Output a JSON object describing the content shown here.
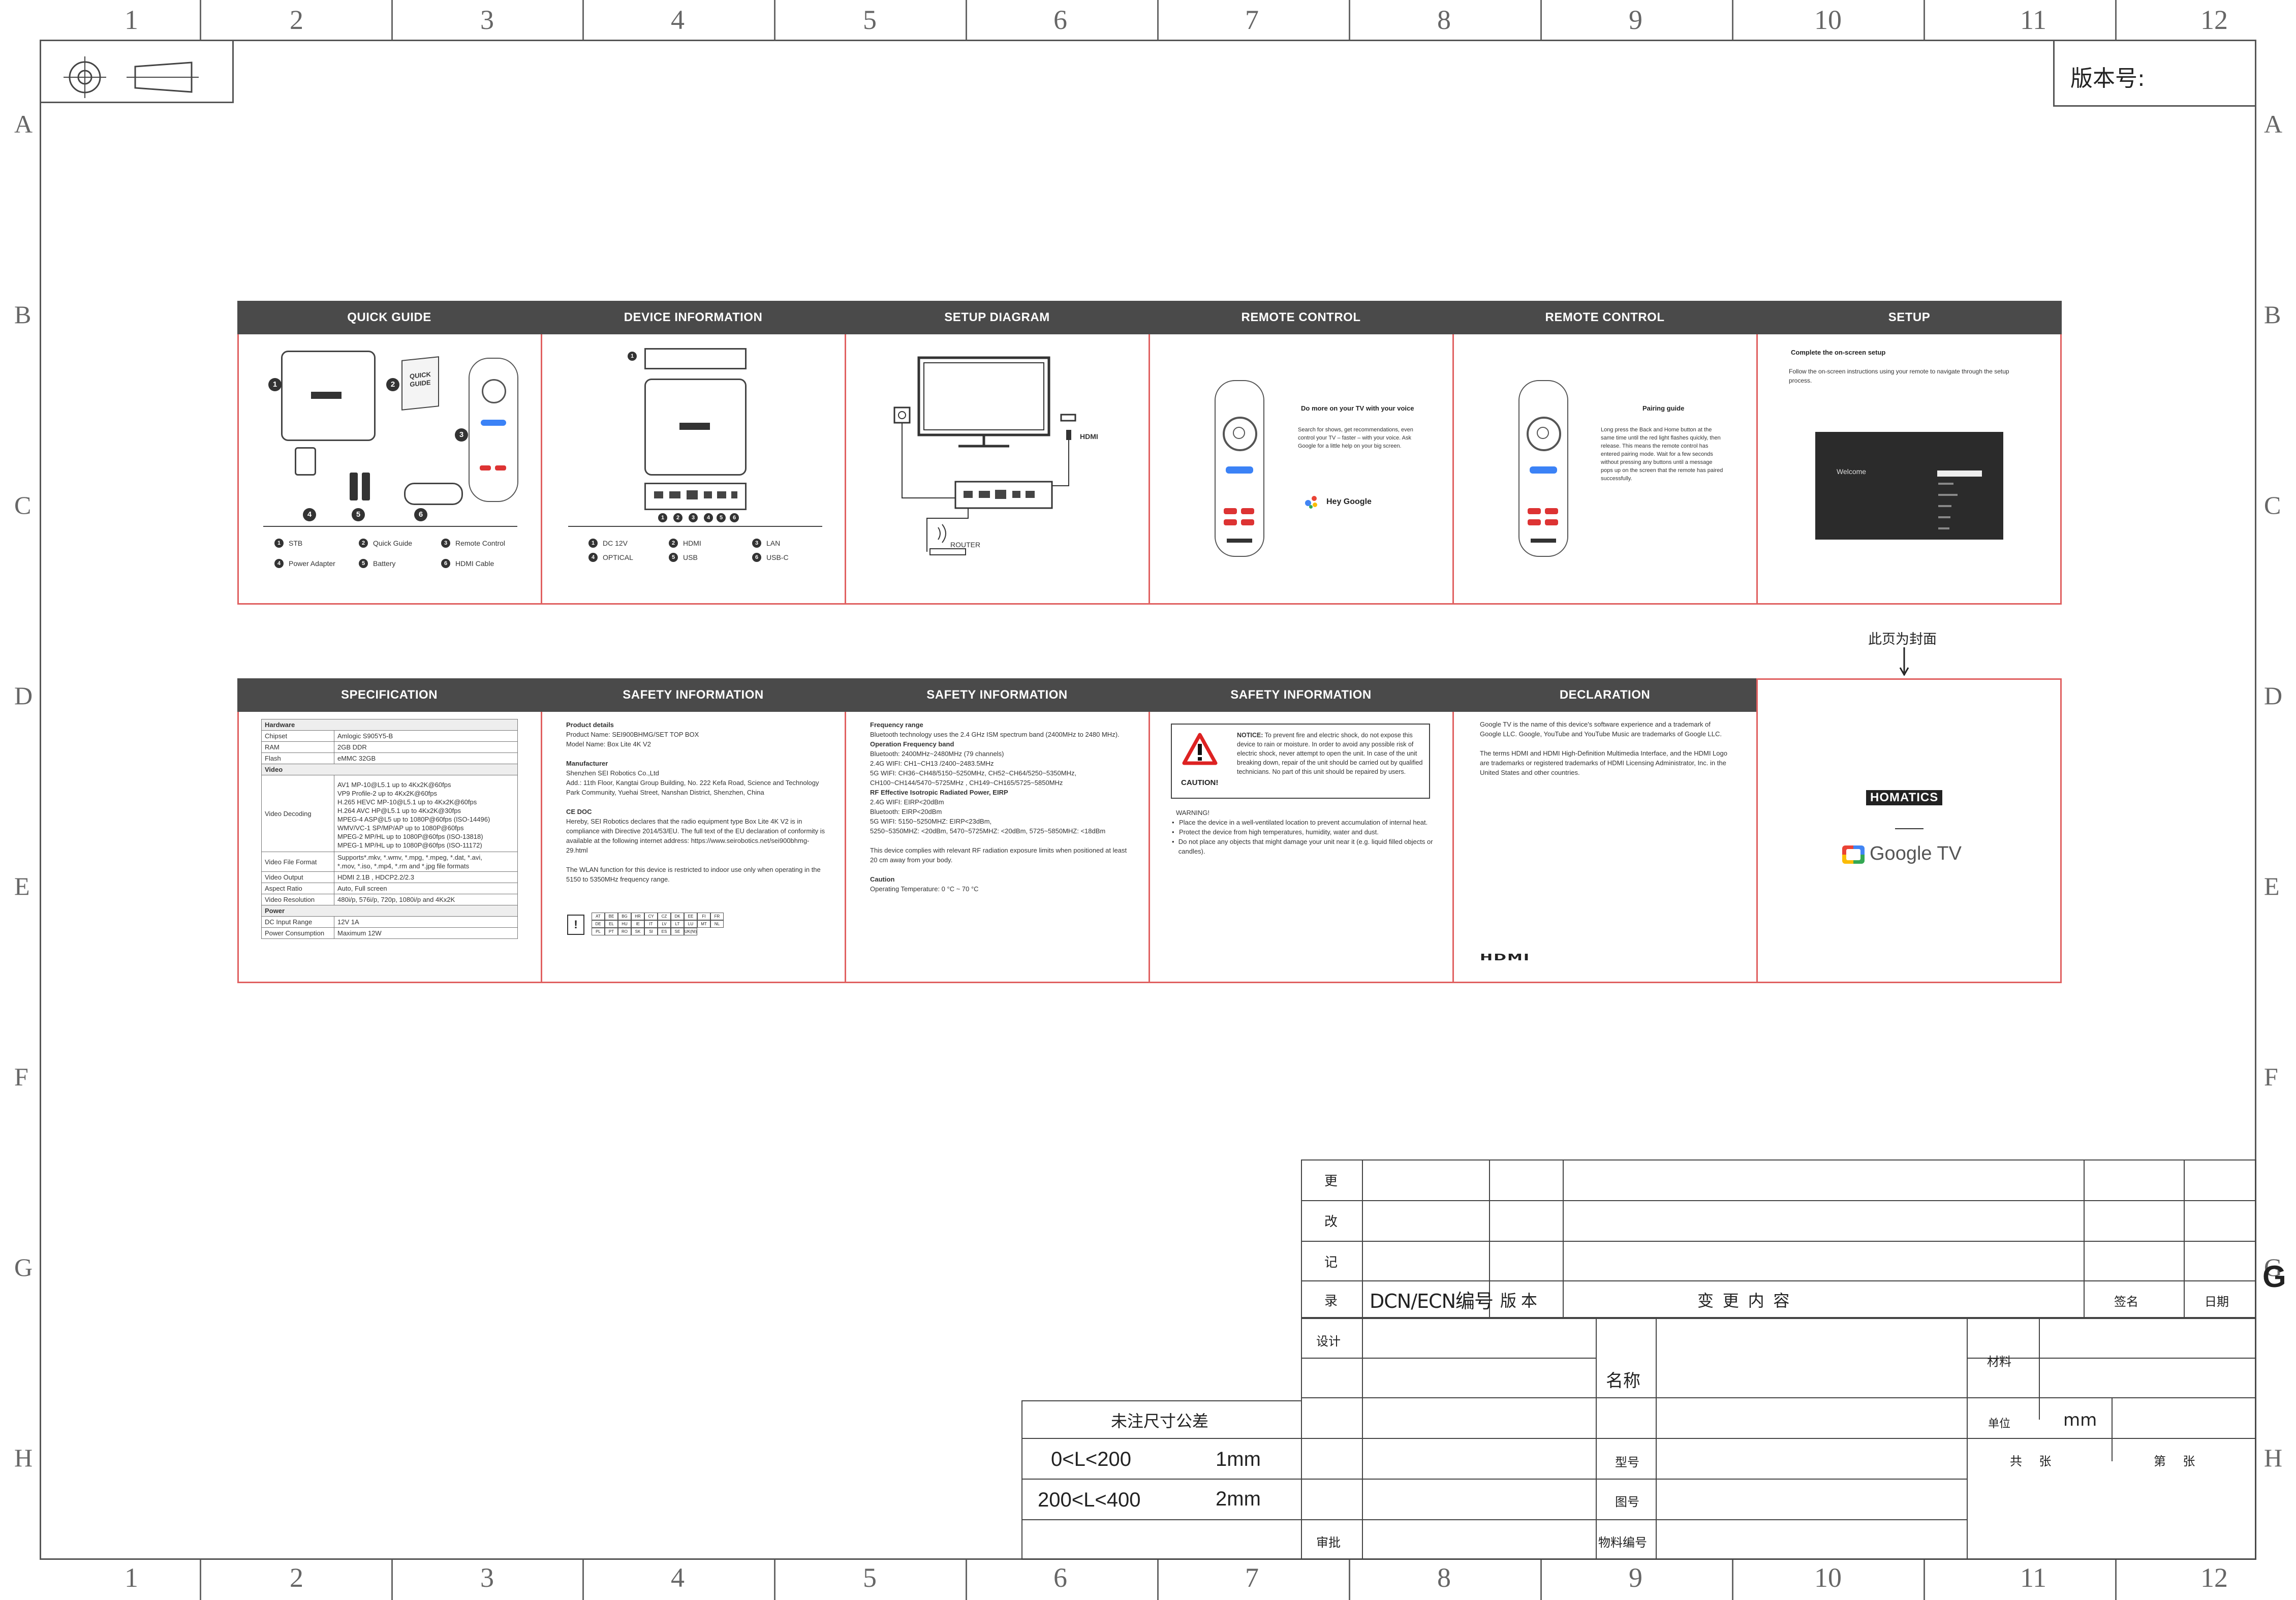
{
  "sheet": {
    "version_label": "版本号:",
    "cover_note": "此页为封面",
    "ruler_numbers": [
      "1",
      "2",
      "3",
      "4",
      "5",
      "6",
      "7",
      "8",
      "9",
      "10",
      "11",
      "12"
    ],
    "ruler_letters": [
      "A",
      "B",
      "C",
      "D",
      "E",
      "F",
      "G",
      "H"
    ],
    "ruler_g_mark": "G"
  },
  "top_row": {
    "headers": [
      "QUICK GUIDE",
      "DEVICE INFORMATION",
      "SETUP DIAGRAM",
      "REMOTE CONTROL",
      "REMOTE CONTROL",
      "SETUP"
    ],
    "quick_guide": {
      "booklet_label": "QUICK GUIDE",
      "legend": [
        {
          "num": "1",
          "text": "STB"
        },
        {
          "num": "2",
          "text": "Quick Guide"
        },
        {
          "num": "3",
          "text": "Remote Control"
        },
        {
          "num": "4",
          "text": "Power Adapter"
        },
        {
          "num": "5",
          "text": "Battery"
        },
        {
          "num": "6",
          "text": "HDMI Cable"
        }
      ]
    },
    "device_info": {
      "legend": [
        {
          "num": "1",
          "text": "DC 12V"
        },
        {
          "num": "2",
          "text": "HDMI"
        },
        {
          "num": "3",
          "text": "LAN"
        },
        {
          "num": "4",
          "text": "OPTICAL"
        },
        {
          "num": "5",
          "text": "USB"
        },
        {
          "num": "6",
          "text": "USB-C"
        }
      ]
    },
    "setup_diagram": {
      "hdmi_label": "HDMI",
      "router_label": "ROUTER"
    },
    "remote1": {
      "title": "Do more on your TV with your voice",
      "body": "Search for shows, get recommendations, even control your TV – faster – with your voice. Ask Google for a little help on your big screen.",
      "hey_google": "Hey Google"
    },
    "remote2": {
      "title": "Pairing guide",
      "body": "Long press the Back and Home button at the same time until the red light flashes quickly, then release. This means the remote control has entered pairing mode. Wait for a few seconds without pressing any buttons until a message pops up on the screen that the remote has paired successfully."
    },
    "setup": {
      "title": "Complete the on-screen setup",
      "body": "Follow the on-screen instructions using your remote to navigate through the setup process.",
      "welcome": "Welcome"
    }
  },
  "bottom_row": {
    "headers": [
      "SPECIFICATION",
      "SAFETY INFORMATION",
      "SAFETY INFORMATION",
      "SAFETY INFORMATION",
      "DECLARATION"
    ],
    "spec_table": [
      {
        "type": "section",
        "label": "Hardware"
      },
      {
        "k": "Chipset",
        "v": "Amlogic S905Y5-B"
      },
      {
        "k": "RAM",
        "v": "2GB DDR"
      },
      {
        "k": "Flash",
        "v": "eMMC 32GB"
      },
      {
        "type": "section",
        "label": "Video"
      },
      {
        "k": "Video Decoding",
        "v": "AV1 MP-10@L5.1 up to 4Kx2K@60fps\nVP9 Profile-2 up to 4Kx2K@60fps\nH.265 HEVC MP-10@L5.1 up to 4Kx2K@60fps\nH.264 AVC HP@L5.1 up to 4Kx2K@30fps\nMPEG-4 ASP@L5 up to 1080P@60fps (ISO-14496)\nWMV/VC-1 SP/MP/AP up to 1080P@60fps\nMPEG-2 MP/HL up to 1080P@60fps (ISO-13818)\nMPEG-1 MP/HL up to 1080P@60fps (ISO-11172)"
      },
      {
        "k": "Video File Format",
        "v": "Supports*.mkv, *.wmv, *.mpg, *.mpeg, *.dat, *.avi,\n*.mov, *.iso, *.mp4, *.rm and *.jpg file formats"
      },
      {
        "k": "Video Output",
        "v": "HDMI 2.1B , HDCP2.2/2.3"
      },
      {
        "k": "Aspect Ratio",
        "v": "Auto, Full screen"
      },
      {
        "k": "Video Resolution",
        "v": "480i/p, 576i/p, 720p, 1080i/p and 4Kx2K"
      },
      {
        "type": "section",
        "label": "Power"
      },
      {
        "k": "DC Input Range",
        "v": "12V 1A"
      },
      {
        "k": "Power Consumption",
        "v": "Maximum 12W"
      }
    ],
    "safety1": {
      "pd_title": "Product details",
      "pd_lines": [
        "Product Name: SEI900BHMG/SET TOP BOX",
        "Model Name: Box Lite 4K V2"
      ],
      "mf_title": "Manufacturer",
      "mf_lines": [
        "Shenzhen SEI Robotics Co.,Ltd",
        "Add.: 11th Floor, Kangtai Group Building, No. 222 Kefa Road, Science and Technology Park Community, Yuehai Street, Nanshan District, Shenzhen, China"
      ],
      "ce_title": "CE DOC",
      "ce_body": "Hereby, SEI Robotics declares that the radio equipment type Box Lite 4K V2 is in compliance with Directive 2014/53/EU. The full text of the EU declaration of conformity is available at the following internet address: https://www.seirobotics.net/sei900bhmg-29.html",
      "wlan_body": "The WLAN function for this device is restricted to indoor use only when operating in the 5150 to 5350MHz frequency range.",
      "countries": [
        "AT",
        "BE",
        "BG",
        "HR",
        "CY",
        "CZ",
        "DK",
        "EE",
        "FI",
        "FR",
        "DE",
        "EL",
        "HU",
        "IE",
        "IT",
        "LV",
        "LT",
        "LU",
        "MT",
        "NL",
        "PL",
        "PT",
        "RO",
        "SK",
        "SI",
        "ES",
        "SE",
        "UK(NI)"
      ]
    },
    "safety2": {
      "fr_title": "Frequency range",
      "fr_body": "Bluetooth technology uses the 2.4 GHz ISM spectrum band (2400MHz to 2480 MHz).",
      "of_title": "Operation Frequency band",
      "of_lines": [
        "Bluetooth: 2400MHz~2480MHz (79 channels)",
        "2.4G WIFI: CH1~CH13 /2400~2483.5MHz",
        "5G WIFI: CH36~CH48/5150~5250MHz, CH52~CH64/5250~5350MHz,",
        "CH100~CH144/5470~5725MHz , CH149~CH165/5725~5850MHz"
      ],
      "eirp_title": "RF Effective Isotropic Radiated Power, EIRP",
      "eirp_lines": [
        "2.4G WIFI: EIRP<20dBm",
        "Bluetooth: EIRP<20dBm",
        "5G WIFI: 5150~5250MHZ: EIRP<23dBm,",
        "5250~5350MHZ: <20dBm, 5470~5725MHZ: <20dBm, 5725~5850MHZ: <18dBm"
      ],
      "rf_body": "This device complies with relevant RF radiation exposure limits when positioned at least 20 cm away from your body.",
      "caution_title": "Caution",
      "caution_body": "Operating Temperature: 0 °C ~ 70 °C"
    },
    "safety3": {
      "caution_label": "CAUTION!",
      "notice_bold": "NOTICE:",
      "notice_body": "To prevent fire and electric shock, do not expose this device to rain or moisture. In order to avoid any possible risk of electric shock, never attempt to open the unit. In case of the unit breaking down, repair of the unit should be carried out by qualified technicians. No part of this unit should be repaired by users.",
      "warning_title": "WARNING!",
      "warnings": [
        "Place the device in a well-ventilated location to prevent accumulation of internal heat.",
        "Protect the device from high temperatures, humidity, water and dust.",
        "Do not place any objects that might damage your unit near it (e.g. liquid filled objects or candles)."
      ]
    },
    "declaration": {
      "p1": "Google TV is the name of this device's software experience and a trademark of Google LLC. Google, YouTube and YouTube Music are trademarks of Google LLC.",
      "p2": "The terms HDMI and HDMI High-Definition Multimedia Interface, and the HDMI Logo are trademarks or registered trademarks of HDMI Licensing Administrator, Inc. in the United States and other countries.",
      "hdmi_logo": "HDMI"
    },
    "cover": {
      "brand": "HOMATICS",
      "google_tv": "Google TV"
    }
  },
  "title_block": {
    "change_vertical": [
      "更",
      "改",
      "记",
      "录"
    ],
    "dcn_label": "DCN/ECN编号",
    "version": "版 本",
    "content": "变  更  内  容",
    "sign": "签名",
    "date": "日期",
    "design": "设计",
    "name": "名称",
    "material": "材料",
    "unit_label": "单位",
    "unit_value": "mm",
    "tolerance_title": "未注尺寸公差",
    "tol_range1": "0<L<200",
    "tol_value1": "1mm",
    "tol_range2": "200<L<400",
    "tol_value2": "2mm",
    "model": "型号",
    "total": "共     张",
    "sheet_no": "第     张",
    "drawing_no": "图号",
    "review": "审批",
    "material_no": "物料编号"
  }
}
